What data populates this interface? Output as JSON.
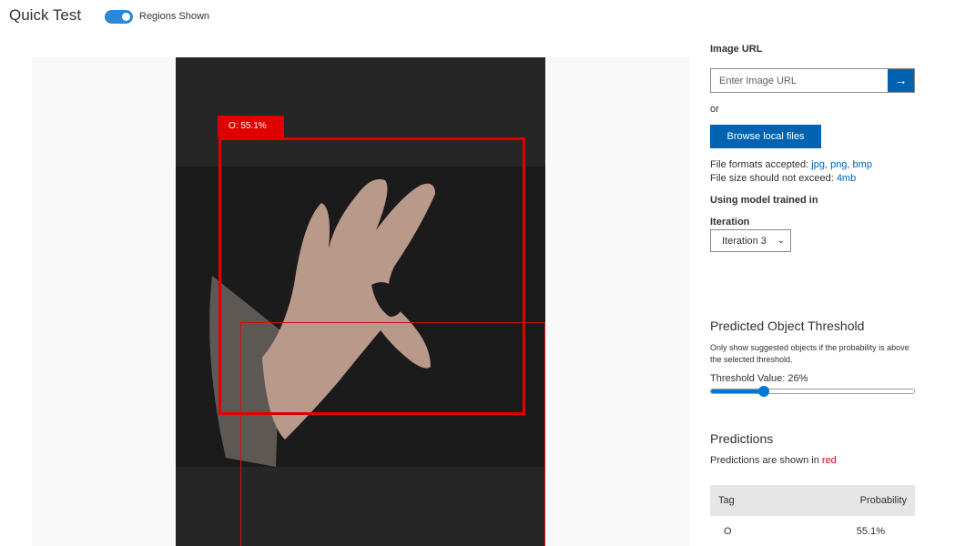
{
  "header": {
    "title": "Quick Test",
    "toggle_label": "Regions Shown",
    "toggle_on": true
  },
  "image": {
    "region_label": "O: 55.1%"
  },
  "panel": {
    "image_url_label": "Image URL",
    "url_placeholder": "Enter Image URL",
    "url_button_icon": "arrow-right-icon",
    "or_text": "or",
    "browse_label": "Browse local files",
    "formats_prefix": "File formats accepted:",
    "formats_list": "jpg, png, bmp",
    "size_prefix": "File size should not exceed:",
    "size_limit": "4mb",
    "model_label": "Using model trained in",
    "iteration_label": "Iteration",
    "iteration_selected": "Iteration 3"
  },
  "threshold": {
    "title": "Predicted Object Threshold",
    "desc": "Only show suggested objects if the probability is above the selected threshold.",
    "value_label": "Threshold Value: 26%",
    "value_percent": 26
  },
  "predictions": {
    "title": "Predictions",
    "desc_prefix": "Predictions are shown in",
    "desc_color_word": "red",
    "columns": [
      "Tag",
      "Probability"
    ],
    "rows": [
      {
        "tag": "O",
        "probability": "55.1%"
      }
    ]
  },
  "colors": {
    "accent": "#0063b1",
    "toggle": "#2b88d8",
    "region": "#e00000"
  }
}
